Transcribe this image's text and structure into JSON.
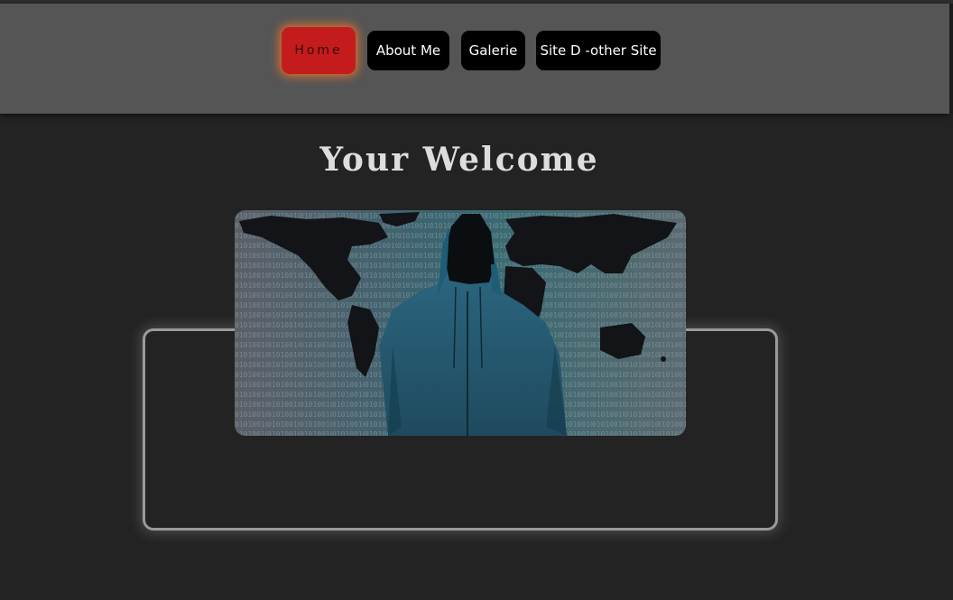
{
  "nav": {
    "items": [
      {
        "label": "Home",
        "active": true
      },
      {
        "label": "About Me",
        "active": false
      },
      {
        "label": "Galerie",
        "active": false
      },
      {
        "label": "Site D -other Site",
        "active": false
      }
    ]
  },
  "main": {
    "heading": "Your Welcome",
    "hero_image": {
      "description_icon": "hooded-figure-world-map-image"
    }
  },
  "colors": {
    "background": "#232323",
    "navbar": "#555555",
    "active_button": "#c41c1c",
    "button": "#000000"
  }
}
